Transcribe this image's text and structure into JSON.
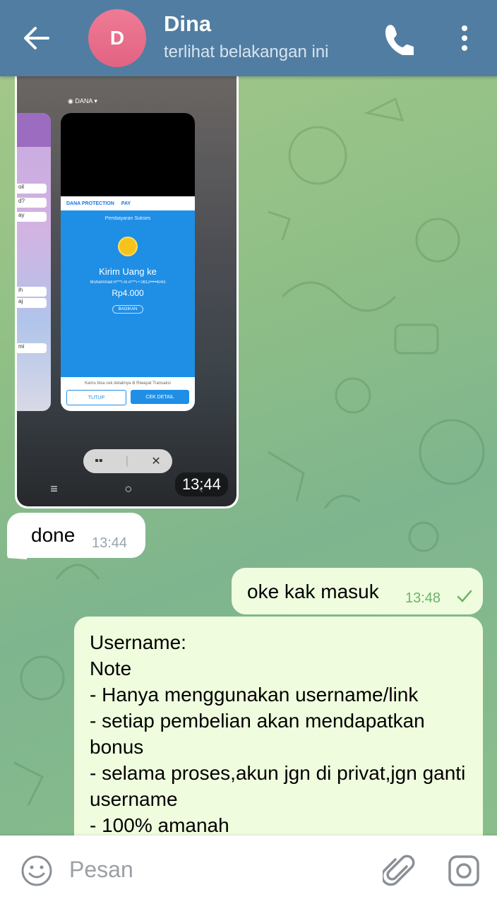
{
  "header": {
    "title": "Dina",
    "status": "terlihat belakangan ini",
    "avatar_letter": "D",
    "avatar_color": "#e46b87",
    "bar_color": "#517da2"
  },
  "messages": {
    "image_time": "13:44",
    "done": {
      "text": "done",
      "time": "13:44"
    },
    "oke": {
      "text": "oke kak masuk",
      "time": "13:48"
    },
    "note": {
      "text": "Username:\nNote\n- Hanya menggunakan username/link\n- setiap pembelian akan mendapatkan bonus\n- selama proses,akun jgn di privat,jgn ganti username\n- 100% amanah"
    }
  },
  "screenshot": {
    "app_label": "DANA",
    "brand_left": "DANA PROTECTION",
    "brand_right": "PAY",
    "status": "Pembayaran Sukses",
    "heading": "Kirim Uang ke",
    "recipient": "Muhammad R***i Al A***i • 0812••••4043",
    "amount": "Rp4.000",
    "share": "BAGIKAN",
    "footer_note": "Kamu bisa cek detailnya di Riwayat Transaksi",
    "btn_close": "TUTUP",
    "btn_detail": "CEK DETAIL"
  },
  "input": {
    "placeholder": "Pesan"
  },
  "icons": [
    "back-arrow-icon",
    "phone-icon",
    "more-vert-icon",
    "emoji-icon",
    "attach-icon",
    "camera-icon",
    "double-check-icon"
  ]
}
